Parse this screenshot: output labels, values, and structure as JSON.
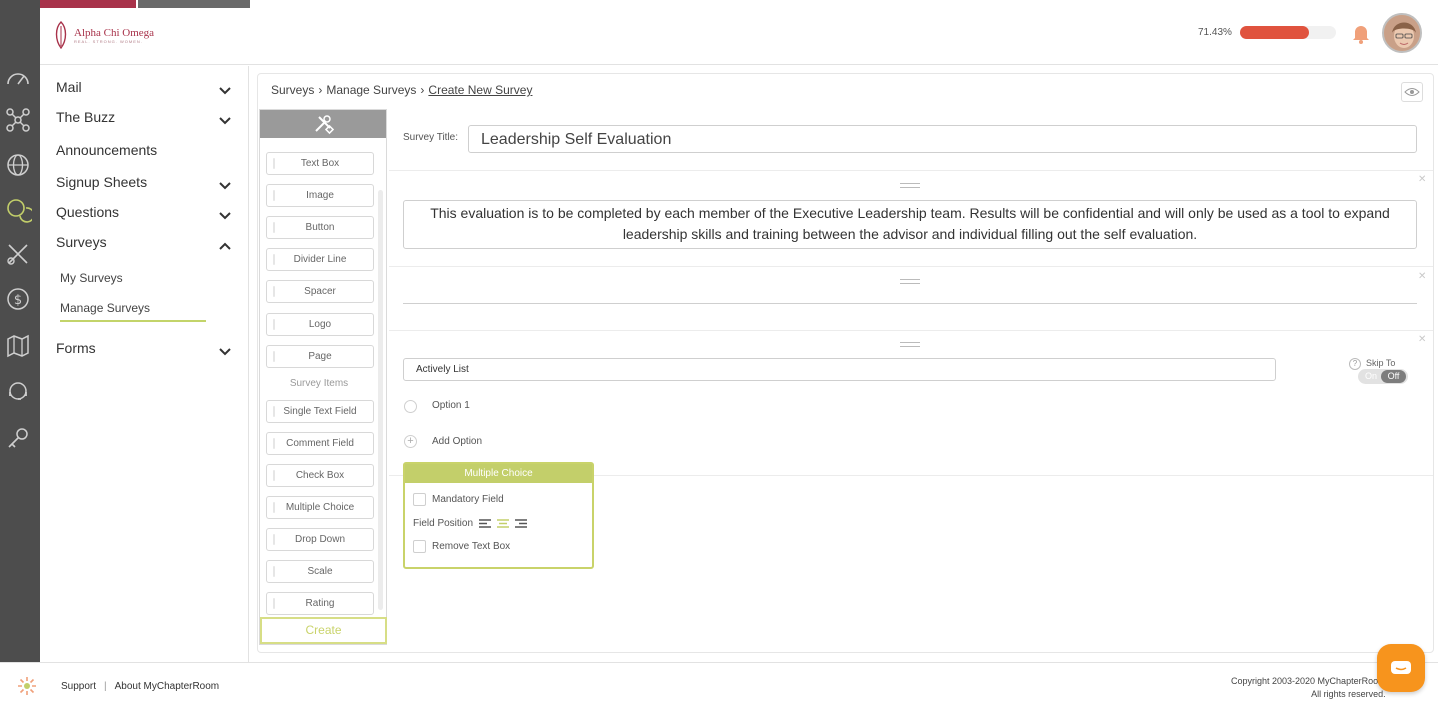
{
  "header": {
    "logo_title": "Alpha Chi Omega",
    "logo_tagline": "REAL. STRONG. WOMEN.",
    "progress_label": "71.43%",
    "progress_value": 0.7143
  },
  "sidebar": {
    "items": [
      {
        "label": "Mail"
      },
      {
        "label": "The Buzz"
      },
      {
        "label": "Announcements"
      },
      {
        "label": "Signup Sheets"
      },
      {
        "label": "Questions"
      },
      {
        "label": "Surveys"
      },
      {
        "label": "Forms"
      }
    ],
    "sub_items": [
      {
        "label": "My Surveys"
      },
      {
        "label": "Manage Surveys"
      }
    ]
  },
  "breadcrumb": {
    "crumbs": [
      "Surveys",
      "Manage Surveys",
      "Create New Survey"
    ]
  },
  "palette": {
    "tools": [
      "Text Box",
      "Image",
      "Button",
      "Divider Line",
      "Spacer",
      "Logo",
      "Page"
    ],
    "section_label": "Survey Items",
    "survey_items": [
      "Single Text Field",
      "Comment Field",
      "Check Box",
      "Multiple Choice",
      "Drop Down",
      "Scale",
      "Rating"
    ],
    "create_label": "Create"
  },
  "builder": {
    "title_label": "Survey Title:",
    "title_value": "Leadership Self Evaluation",
    "description": "This evaluation is to be completed by each member of the Executive Leadership team. Results will be confidential and will only be used as a tool to expand leadership skills and training between the advisor and individual filling out the self evaluation.",
    "question_value": "Actively List",
    "option1": "Option 1",
    "add_option": "Add Option",
    "skip_to": "Skip To",
    "toggle_on": "On",
    "toggle_off": "Off",
    "help": "?"
  },
  "mc_card": {
    "title": "Multiple Choice",
    "mandatory": "Mandatory Field",
    "field_position": "Field Position",
    "remove_text_box": "Remove Text Box"
  },
  "footer": {
    "support": "Support",
    "sep": "|",
    "about": "About MyChapterRoom",
    "copyright_line1": "Copyright 2003-2020 MyChapterRoom",
    "copyright_line2": "All rights reserved."
  },
  "colors": {
    "accent_green": "#c3cf6a",
    "brand_red": "#a8324a",
    "progress": "#e0533e",
    "chat": "#f7941d"
  },
  "icons": [
    "dashboard-icon",
    "network-icon",
    "globe-icon",
    "chat-bubbles-icon",
    "tools-icon",
    "dollar-icon",
    "map-icon",
    "support-icon",
    "key-icon",
    "bell-icon",
    "eye-icon",
    "wrench-screwdriver-icon"
  ]
}
